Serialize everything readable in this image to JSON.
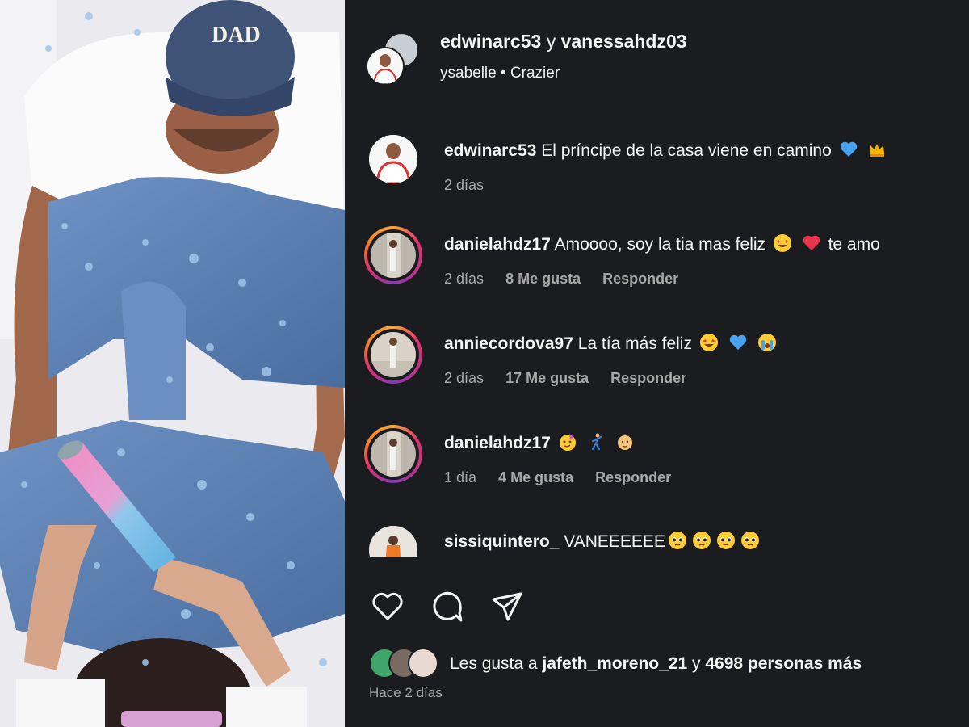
{
  "photo": {
    "alt_icon": "gender-reveal-photo",
    "cap_text": "DAD"
  },
  "post": {
    "header": {
      "title_a": "edwinarc53",
      "title_join": "y",
      "title_b": "vanessahdz03",
      "music_artist": "ysabelle",
      "music_sep": "•",
      "music_track": "Crazier"
    },
    "comments": [
      {
        "user": "edwinarc53",
        "text": "El príncipe de la casa viene en camino",
        "emojis": [
          "blue-heart",
          "crown"
        ],
        "time": "2 días",
        "likes": "",
        "reply": ""
      },
      {
        "user": "danielahdz17",
        "text": "Amoooo, soy la tia mas feliz",
        "emojis": [
          "heart-eyes",
          "red-heart"
        ],
        "text_after": "te amo",
        "time": "2 días",
        "likes": "8 Me gusta",
        "reply": "Responder"
      },
      {
        "user": "anniecordova97",
        "text": "La tía más feliz",
        "emojis": [
          "heart-eyes",
          "blue-heart",
          "crying"
        ],
        "time": "2 días",
        "likes": "17 Me gusta",
        "reply": "Responder"
      },
      {
        "user": "danielahdz17",
        "text": "",
        "emojis": [
          "party-face",
          "dancing-man",
          "baby"
        ],
        "time": "1 día",
        "likes": "4 Me gusta",
        "reply": "Responder"
      },
      {
        "user": "sissiquintero_",
        "text": "VANEEEEEE",
        "emojis": [
          "pleading",
          "pleading",
          "pleading",
          "pleading"
        ],
        "time": "",
        "likes": "",
        "reply": ""
      }
    ],
    "actions": {
      "like_icon": "heart-icon",
      "comment_icon": "comment-icon",
      "share_icon": "send-icon"
    },
    "likes_summary": {
      "prefix": "Les gusta a",
      "user": "jafeth_moreno_21",
      "middle": "y",
      "count": "4698 personas más"
    },
    "posted": "Hace 2 días"
  },
  "colors": {
    "panel_bg": "#1b1c1f",
    "text": "#f5f5f5",
    "muted": "#a8a8a8",
    "denim": "#5b7fb0",
    "cap": "#3f5377"
  }
}
